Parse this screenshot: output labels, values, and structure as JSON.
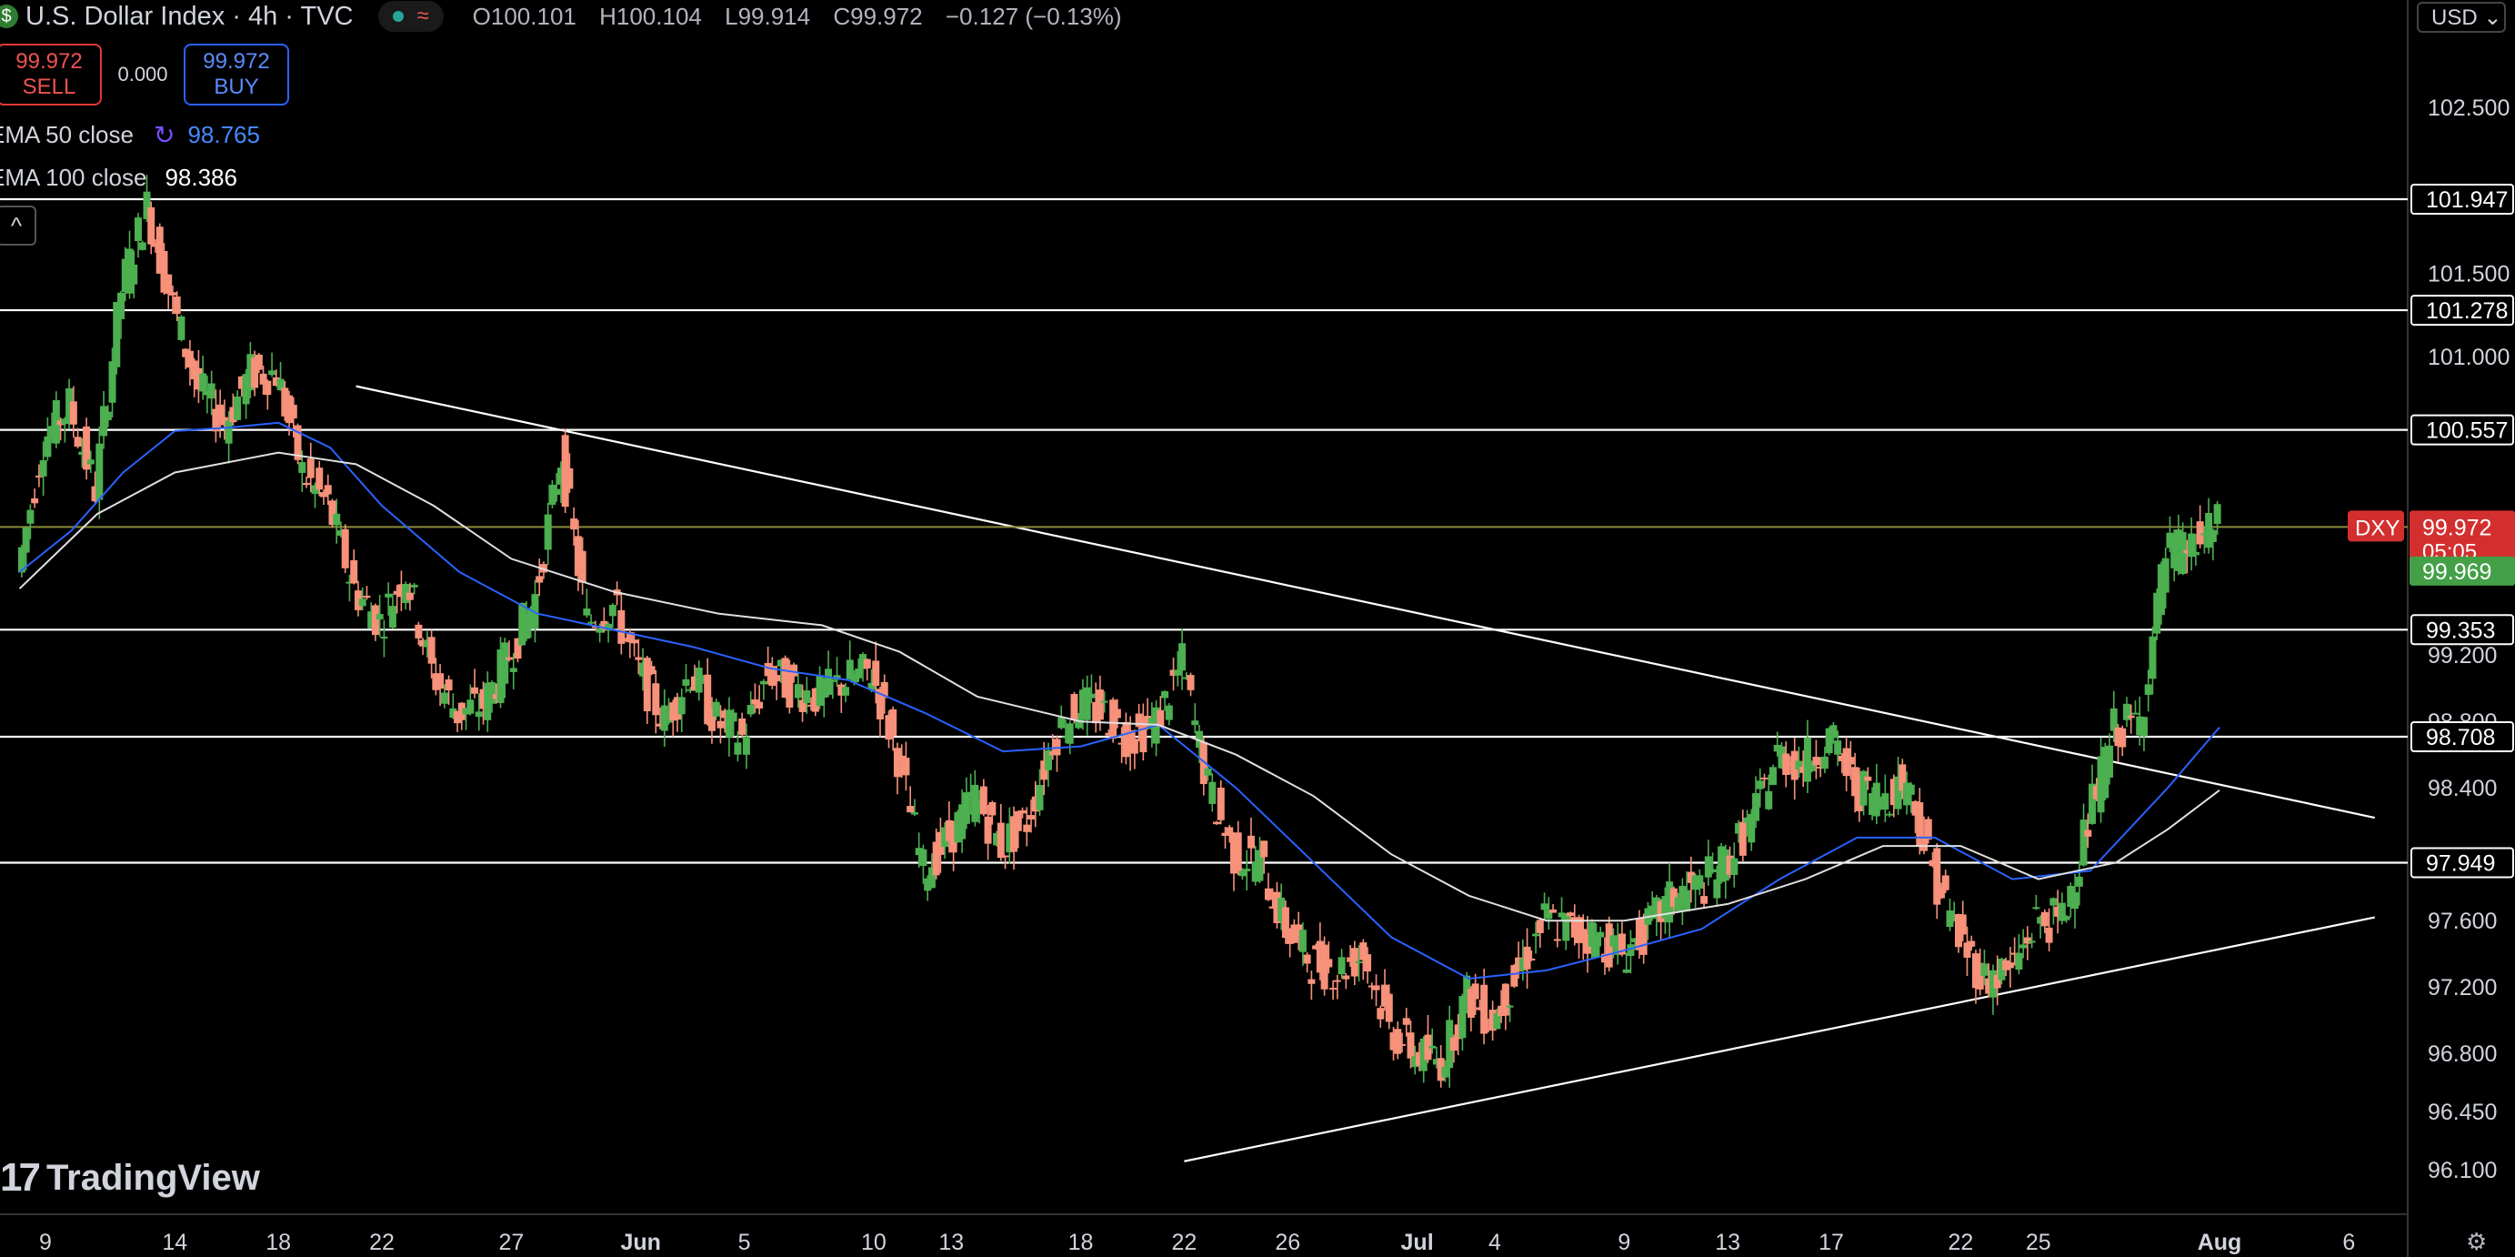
{
  "header": {
    "symbol_icon": "$",
    "title": "U.S. Dollar Index · 4h · TVC",
    "status_icons": [
      "market-open-dot",
      "wave-icon"
    ],
    "wave_glyph": "≈",
    "ohlc": {
      "o": "O100.101",
      "h": "H100.104",
      "l": "L99.914",
      "c": "C99.972",
      "chg": "−0.127 (−0.13%)"
    }
  },
  "trade": {
    "sell_price": "99.972",
    "sell_label": "SELL",
    "spread": "0.000",
    "buy_price": "99.972",
    "buy_label": "BUY"
  },
  "indicators": {
    "ema50_label": "EMA 50 close",
    "ema50_value": "98.765",
    "ema100_label": "EMA 100 close",
    "ema100_value": "98.386",
    "refresh_glyph": "↻"
  },
  "collapse_glyph": "^",
  "currency": "USD ⌄",
  "logo": {
    "mark": "17",
    "text": "TradingView"
  },
  "settings_glyph": "⚙",
  "colors": {
    "up": "#4caf50",
    "down": "#f7917a",
    "ema50": "#2962ff",
    "ema100": "#e0e0e0",
    "hline": "#ffffff",
    "price_line": "#8a8a3a",
    "price_label": "#d32f2f",
    "bid_label": "#43a047"
  },
  "chart_data": {
    "type": "candlestick",
    "title": "U.S. Dollar Index · 4h · TVC",
    "ylim": [
      96.0,
      102.8
    ],
    "y_ticks": [
      "102.500",
      "101.500",
      "101.000",
      "99.200",
      "98.800",
      "98.400",
      "97.600",
      "97.200",
      "96.800",
      "96.450",
      "96.100"
    ],
    "x_ticks": [
      {
        "label": "9",
        "date": "2025-05-09"
      },
      {
        "label": "14",
        "date": "2025-05-14"
      },
      {
        "label": "18",
        "date": "2025-05-18"
      },
      {
        "label": "22",
        "date": "2025-05-22"
      },
      {
        "label": "27",
        "date": "2025-05-27"
      },
      {
        "label": "Jun",
        "date": "2025-06-01"
      },
      {
        "label": "5",
        "date": "2025-06-05"
      },
      {
        "label": "10",
        "date": "2025-06-10"
      },
      {
        "label": "13",
        "date": "2025-06-13"
      },
      {
        "label": "18",
        "date": "2025-06-18"
      },
      {
        "label": "22",
        "date": "2025-06-22"
      },
      {
        "label": "26",
        "date": "2025-06-26"
      },
      {
        "label": "Jul",
        "date": "2025-07-01"
      },
      {
        "label": "4",
        "date": "2025-07-04"
      },
      {
        "label": "9",
        "date": "2025-07-09"
      },
      {
        "label": "13",
        "date": "2025-07-13"
      },
      {
        "label": "17",
        "date": "2025-07-17"
      },
      {
        "label": "22",
        "date": "2025-07-22"
      },
      {
        "label": "25",
        "date": "2025-07-25"
      },
      {
        "label": "Aug",
        "date": "2025-08-01"
      },
      {
        "label": "6",
        "date": "2025-08-06"
      }
    ],
    "horizontal_levels": [
      {
        "value": 101.947,
        "label": "101.947"
      },
      {
        "value": 101.278,
        "label": "101.278"
      },
      {
        "value": 100.557,
        "label": "100.557"
      },
      {
        "value": 99.353,
        "label": "99.353"
      },
      {
        "value": 98.708,
        "label": "98.708"
      },
      {
        "value": 97.949,
        "label": "97.949"
      }
    ],
    "trendlines": [
      {
        "from": [
          "2025-05-21",
          100.82
        ],
        "to": [
          "2025-08-07",
          98.22
        ]
      },
      {
        "from": [
          "2025-06-22",
          96.15
        ],
        "to": [
          "2025-08-07",
          97.62
        ]
      }
    ],
    "last_price": {
      "value": 99.972,
      "symbol": "DXY",
      "label": "99.972",
      "countdown": "05:05"
    },
    "bid_price": {
      "value": 99.969,
      "label": "99.969"
    },
    "series": [
      {
        "name": "U.S. Dollar Index",
        "path_points": [
          [
            "2025-05-08",
            99.7
          ],
          [
            "2025-05-09",
            100.5
          ],
          [
            "2025-05-10",
            100.7
          ],
          [
            "2025-05-11",
            100.2
          ],
          [
            "2025-05-12",
            101.4
          ],
          [
            "2025-05-13",
            101.9
          ],
          [
            "2025-05-14",
            101.3
          ],
          [
            "2025-05-15",
            100.8
          ],
          [
            "2025-05-16",
            100.6
          ],
          [
            "2025-05-17",
            100.9
          ],
          [
            "2025-05-18",
            100.9
          ],
          [
            "2025-05-19",
            100.3
          ],
          [
            "2025-05-20",
            100.1
          ],
          [
            "2025-05-21",
            99.6
          ],
          [
            "2025-05-22",
            99.4
          ],
          [
            "2025-05-23",
            99.7
          ],
          [
            "2025-05-24",
            99.1
          ],
          [
            "2025-05-25",
            98.85
          ],
          [
            "2025-05-26",
            98.9
          ],
          [
            "2025-05-27",
            99.2
          ],
          [
            "2025-05-28",
            99.55
          ],
          [
            "2025-05-29",
            100.4
          ],
          [
            "2025-05-30",
            99.4
          ],
          [
            "2025-05-31",
            99.5
          ],
          [
            "2025-06-01",
            99.1
          ],
          [
            "2025-06-02",
            98.8
          ],
          [
            "2025-06-03",
            99.1
          ],
          [
            "2025-06-04",
            98.8
          ],
          [
            "2025-06-05",
            98.7
          ],
          [
            "2025-06-06",
            99.1
          ],
          [
            "2025-06-07",
            99.0
          ],
          [
            "2025-06-08",
            98.95
          ],
          [
            "2025-06-09",
            99.05
          ],
          [
            "2025-06-10",
            99.1
          ],
          [
            "2025-06-11",
            98.6
          ],
          [
            "2025-06-12",
            97.9
          ],
          [
            "2025-06-13",
            98.1
          ],
          [
            "2025-06-14",
            98.35
          ],
          [
            "2025-06-15",
            98.05
          ],
          [
            "2025-06-16",
            98.2
          ],
          [
            "2025-06-17",
            98.7
          ],
          [
            "2025-06-18",
            98.9
          ],
          [
            "2025-06-19",
            98.85
          ],
          [
            "2025-06-20",
            98.7
          ],
          [
            "2025-06-21",
            98.8
          ],
          [
            "2025-06-22",
            99.15
          ],
          [
            "2025-06-23",
            98.4
          ],
          [
            "2025-06-24",
            98.0
          ],
          [
            "2025-06-25",
            97.95
          ],
          [
            "2025-06-26",
            97.55
          ],
          [
            "2025-06-27",
            97.35
          ],
          [
            "2025-06-28",
            97.3
          ],
          [
            "2025-06-29",
            97.4
          ],
          [
            "2025-06-30",
            96.95
          ],
          [
            "2025-07-01",
            96.8
          ],
          [
            "2025-07-02",
            96.75
          ],
          [
            "2025-07-03",
            97.15
          ],
          [
            "2025-07-04",
            97.0
          ],
          [
            "2025-07-05",
            97.3
          ],
          [
            "2025-07-06",
            97.6
          ],
          [
            "2025-07-07",
            97.55
          ],
          [
            "2025-07-08",
            97.5
          ],
          [
            "2025-07-09",
            97.4
          ],
          [
            "2025-07-10",
            97.55
          ],
          [
            "2025-07-11",
            97.75
          ],
          [
            "2025-07-12",
            97.8
          ],
          [
            "2025-07-13",
            97.95
          ],
          [
            "2025-07-14",
            98.2
          ],
          [
            "2025-07-15",
            98.6
          ],
          [
            "2025-07-16",
            98.55
          ],
          [
            "2025-07-17",
            98.7
          ],
          [
            "2025-07-18",
            98.4
          ],
          [
            "2025-07-19",
            98.35
          ],
          [
            "2025-07-20",
            98.45
          ],
          [
            "2025-07-21",
            97.9
          ],
          [
            "2025-07-22",
            97.5
          ],
          [
            "2025-07-23",
            97.25
          ],
          [
            "2025-07-24",
            97.3
          ],
          [
            "2025-07-25",
            97.6
          ],
          [
            "2025-07-26",
            97.6
          ],
          [
            "2025-07-27",
            98.2
          ],
          [
            "2025-07-28",
            98.75
          ],
          [
            "2025-07-29",
            98.8
          ],
          [
            "2025-07-30",
            99.8
          ],
          [
            "2025-07-31",
            99.85
          ],
          [
            "2025-08-01",
            99.97
          ]
        ]
      },
      {
        "name": "EMA 50 close",
        "points": [
          [
            "2025-05-08",
            99.7
          ],
          [
            "2025-05-10",
            99.95
          ],
          [
            "2025-05-12",
            100.3
          ],
          [
            "2025-05-14",
            100.55
          ],
          [
            "2025-05-16",
            100.57
          ],
          [
            "2025-05-18",
            100.6
          ],
          [
            "2025-05-20",
            100.45
          ],
          [
            "2025-05-22",
            100.1
          ],
          [
            "2025-05-25",
            99.7
          ],
          [
            "2025-05-28",
            99.45
          ],
          [
            "2025-05-31",
            99.35
          ],
          [
            "2025-06-03",
            99.25
          ],
          [
            "2025-06-06",
            99.12
          ],
          [
            "2025-06-09",
            99.05
          ],
          [
            "2025-06-12",
            98.85
          ],
          [
            "2025-06-15",
            98.62
          ],
          [
            "2025-06-18",
            98.65
          ],
          [
            "2025-06-21",
            98.78
          ],
          [
            "2025-06-24",
            98.4
          ],
          [
            "2025-06-27",
            97.95
          ],
          [
            "2025-06-30",
            97.5
          ],
          [
            "2025-07-03",
            97.25
          ],
          [
            "2025-07-06",
            97.3
          ],
          [
            "2025-07-09",
            97.42
          ],
          [
            "2025-07-12",
            97.55
          ],
          [
            "2025-07-15",
            97.85
          ],
          [
            "2025-07-18",
            98.1
          ],
          [
            "2025-07-21",
            98.1
          ],
          [
            "2025-07-24",
            97.85
          ],
          [
            "2025-07-27",
            97.9
          ],
          [
            "2025-07-30",
            98.4
          ],
          [
            "2025-08-01",
            98.765
          ]
        ]
      },
      {
        "name": "EMA 100 close",
        "points": [
          [
            "2025-05-08",
            99.6
          ],
          [
            "2025-05-11",
            100.05
          ],
          [
            "2025-05-14",
            100.3
          ],
          [
            "2025-05-18",
            100.42
          ],
          [
            "2025-05-21",
            100.35
          ],
          [
            "2025-05-24",
            100.1
          ],
          [
            "2025-05-27",
            99.78
          ],
          [
            "2025-05-31",
            99.58
          ],
          [
            "2025-06-04",
            99.45
          ],
          [
            "2025-06-08",
            99.38
          ],
          [
            "2025-06-11",
            99.22
          ],
          [
            "2025-06-14",
            98.95
          ],
          [
            "2025-06-18",
            98.8
          ],
          [
            "2025-06-21",
            98.78
          ],
          [
            "2025-06-24",
            98.6
          ],
          [
            "2025-06-27",
            98.35
          ],
          [
            "2025-06-30",
            98.0
          ],
          [
            "2025-07-03",
            97.75
          ],
          [
            "2025-07-06",
            97.6
          ],
          [
            "2025-07-09",
            97.6
          ],
          [
            "2025-07-13",
            97.7
          ],
          [
            "2025-07-16",
            97.85
          ],
          [
            "2025-07-19",
            98.05
          ],
          [
            "2025-07-22",
            98.05
          ],
          [
            "2025-07-25",
            97.85
          ],
          [
            "2025-07-28",
            97.95
          ],
          [
            "2025-07-30",
            98.15
          ],
          [
            "2025-08-01",
            98.386
          ]
        ]
      }
    ]
  }
}
